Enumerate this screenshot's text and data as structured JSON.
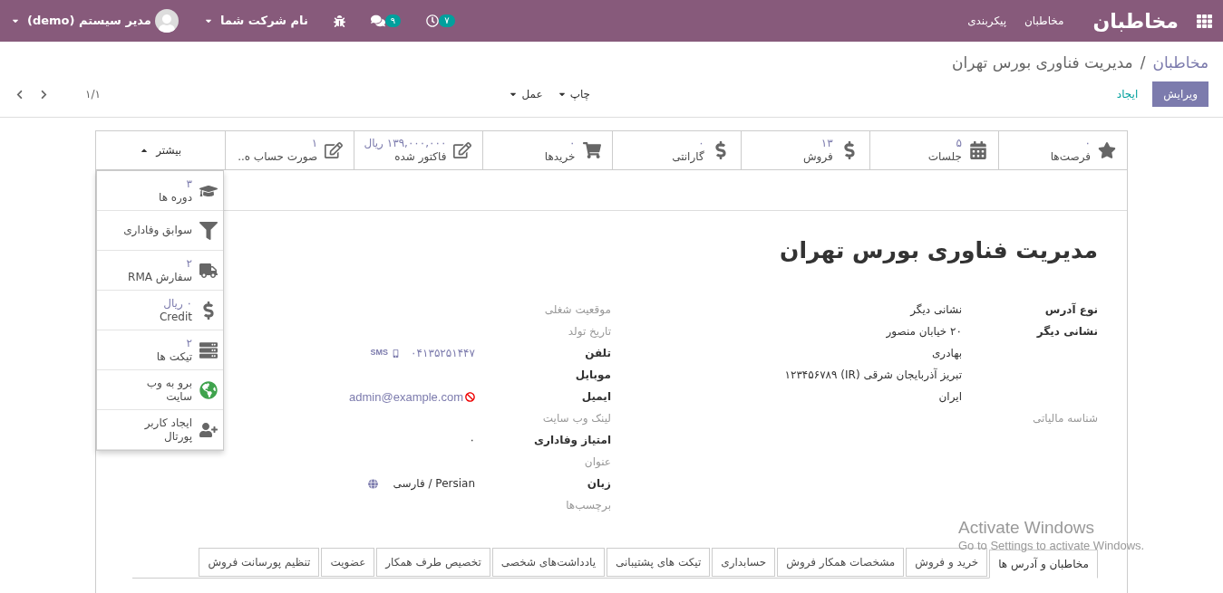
{
  "navbar": {
    "app_title": "مخاطبان",
    "menu": [
      "مخاطبان",
      "پیکربندی"
    ],
    "activity_count": "۷",
    "message_count": "۹",
    "company": "نام شرکت شما",
    "user": "مدیر سیستم (demo)"
  },
  "breadcrumb": {
    "parent": "مخاطبان",
    "separator": "/",
    "current": "مدیریت فناوری بورس تهران"
  },
  "actions": {
    "edit": "ویرایش",
    "create": "ایجاد",
    "print": "چاپ",
    "action": "عمل"
  },
  "pager": "۱/۱",
  "stat_buttons": [
    {
      "value": "۰",
      "label": "فرصت‌ها"
    },
    {
      "value": "۵",
      "label": "جلسات"
    },
    {
      "value": "۱۳",
      "label": "فروش"
    },
    {
      "value": "۰",
      "label": "گارانتی"
    },
    {
      "value": "۰",
      "label": "خریدها"
    },
    {
      "value": "۱۳۹,۰۰۰,۰۰۰ ریال",
      "label": "فاکتور شده"
    },
    {
      "value": "۱",
      "label": "صورت حساب ه.."
    }
  ],
  "more": {
    "label": "بیشتر",
    "expanded": true,
    "items": [
      {
        "value": "۳",
        "label": "دوره ها"
      },
      {
        "label": "سوابق وفاداری"
      },
      {
        "value": "۲",
        "label": "سفارش RMA"
      },
      {
        "value": "۰ ریال",
        "label": "Credit"
      },
      {
        "value": "۲",
        "label": "تیکت ها"
      },
      {
        "label": "برو به وب سایت"
      },
      {
        "label": "ایجاد کاربر پورتال"
      }
    ]
  },
  "title": "مدیریت فناوری بورس تهران",
  "address_group": {
    "rows": [
      {
        "label": "نوع آدرس",
        "filled": true,
        "value": "نشانی دیگر"
      },
      {
        "label": "نشانی دیگر",
        "filled": true,
        "value": "۲۰ خیابان منصور"
      },
      {
        "value": "بهادری"
      },
      {
        "value": "تبریز  آذربایجان شرقی (IR)  ۱۲۳۴۵۶۷۸۹"
      },
      {
        "value": "ایران"
      },
      {
        "label": "شناسه مالیاتی",
        "filled": false
      }
    ]
  },
  "contact_group": {
    "rows": [
      {
        "label": "موقعیت شغلی",
        "filled": false
      },
      {
        "label": "تاریخ تولد",
        "filled": false
      },
      {
        "label": "تلفن",
        "filled": true,
        "kind": "phone",
        "value": "۰۴۱۳۵۲۵۱۴۴۷",
        "action": "SMS"
      },
      {
        "label": "موبایل",
        "filled": true
      },
      {
        "label": "ایمیل",
        "filled": true,
        "kind": "email",
        "value": "admin@example.com"
      },
      {
        "label": "لینک وب سایت",
        "filled": false
      },
      {
        "label": "امتیاز وفاداری",
        "filled": true,
        "kind": "text",
        "value": "۰"
      },
      {
        "label": "عنوان",
        "filled": false
      },
      {
        "label": "زبان",
        "filled": true,
        "kind": "language",
        "value": "Persian / فارسی"
      },
      {
        "label": "برچسب‌ها",
        "filled": false
      }
    ]
  },
  "tabs": [
    {
      "label": "مخاطبان و آدرس ها",
      "selected": true
    },
    {
      "label": "خرید و فروش",
      "selected": false
    },
    {
      "label": "مشخصات همکار فروش",
      "selected": false
    },
    {
      "label": "حسابداری",
      "selected": false
    },
    {
      "label": "تیکت های پشتیبانی",
      "selected": false
    },
    {
      "label": "یادداشت‌های شخصی",
      "selected": false
    },
    {
      "label": "تخصیص طرف همکار",
      "selected": false
    },
    {
      "label": "عضویت",
      "selected": false
    },
    {
      "label": "تنظیم پورسانت فروش",
      "selected": false
    }
  ],
  "os_notice": {
    "title": "Activate Windows",
    "text": "Go to Settings to activate Windows."
  }
}
